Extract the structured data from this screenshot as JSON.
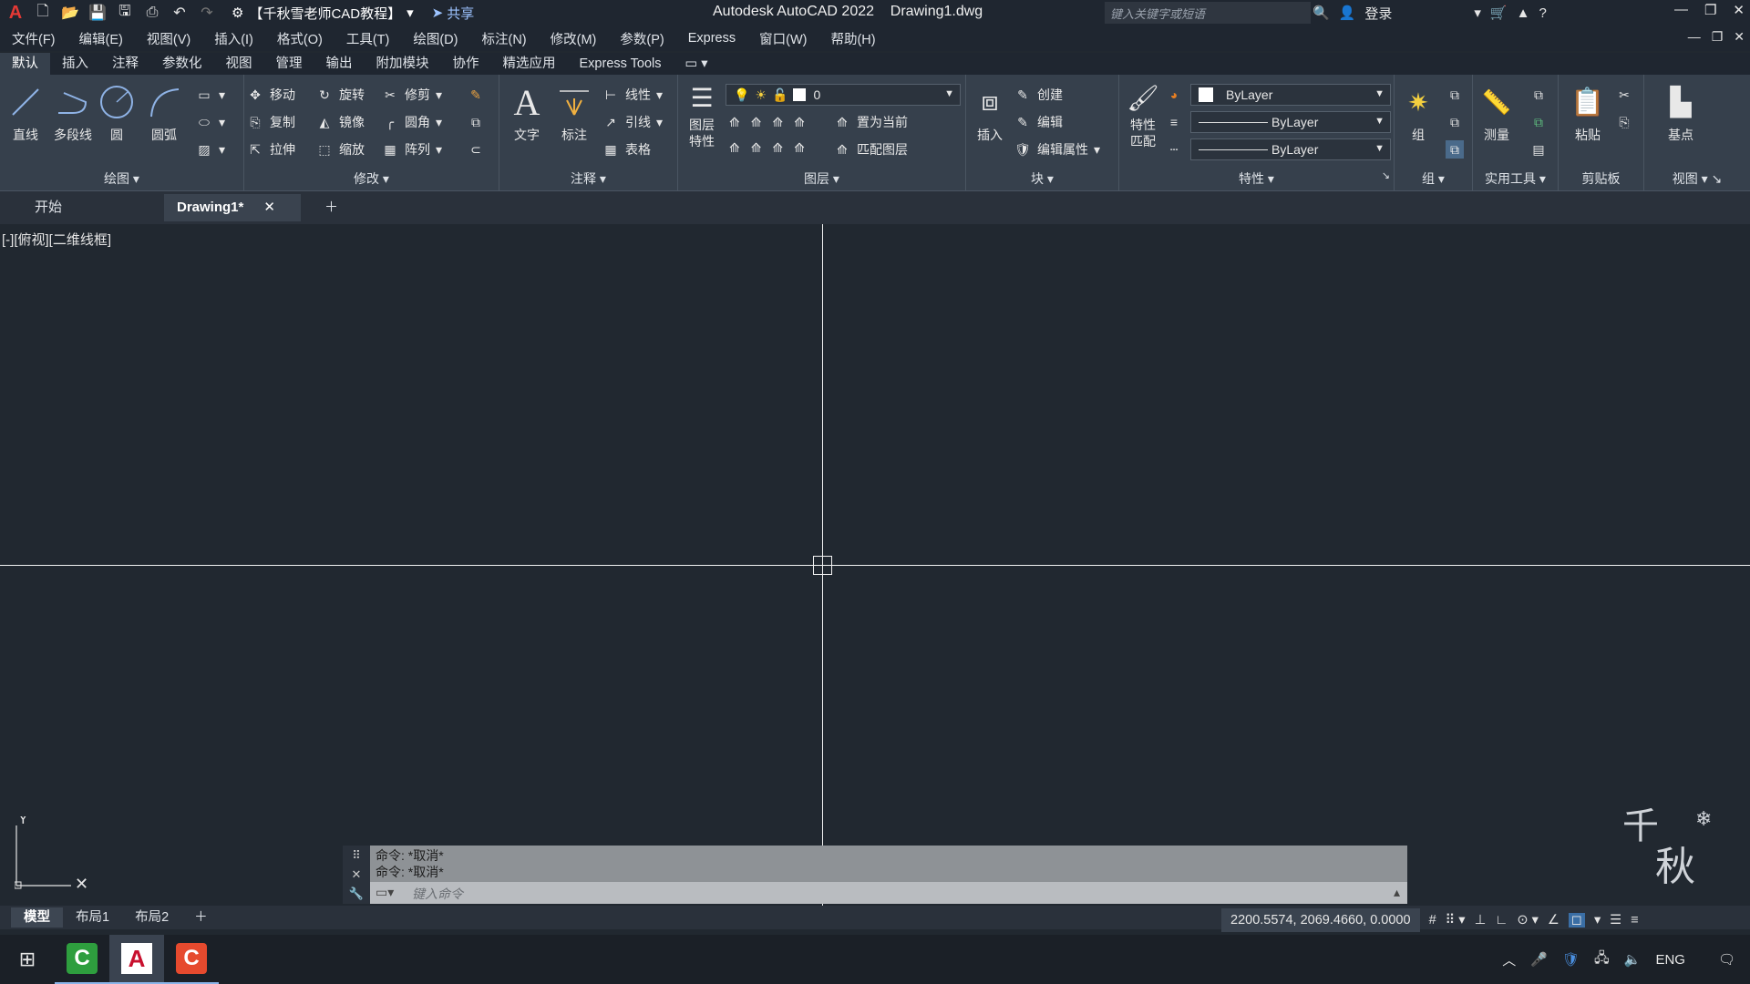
{
  "titlebar": {
    "workspace": "【千秋雪老师CAD教程】",
    "share": "共享",
    "app_title": "Autodesk AutoCAD 2022",
    "doc_title": "Drawing1.dwg",
    "search_placeholder": "键入关键字或短语",
    "login": "登录"
  },
  "menu": [
    "文件(F)",
    "编辑(E)",
    "视图(V)",
    "插入(I)",
    "格式(O)",
    "工具(T)",
    "绘图(D)",
    "标注(N)",
    "修改(M)",
    "参数(P)",
    "Express",
    "窗口(W)",
    "帮助(H)"
  ],
  "ribbon_tabs": [
    "默认",
    "插入",
    "注释",
    "参数化",
    "视图",
    "管理",
    "输出",
    "附加模块",
    "协作",
    "精选应用",
    "Express Tools"
  ],
  "panels": {
    "draw": {
      "title": "绘图",
      "line": "直线",
      "polyline": "多段线",
      "circle": "圆",
      "arc": "圆弧"
    },
    "modify": {
      "title": "修改",
      "move": "移动",
      "rotate": "旋转",
      "trim": "修剪",
      "copy": "复制",
      "mirror": "镜像",
      "fillet": "圆角",
      "stretch": "拉伸",
      "scale": "缩放",
      "array": "阵列"
    },
    "annotation": {
      "title": "注释",
      "text": "文字",
      "dimension": "标注",
      "linear": "线性",
      "leader": "引线",
      "table": "表格"
    },
    "layers": {
      "title": "图层",
      "properties_line1": "图层",
      "properties_line2": "特性",
      "layer_value": "0",
      "set_current": "置为当前",
      "match_layer": "匹配图层"
    },
    "block": {
      "title": "块",
      "insert": "插入",
      "create": "创建",
      "edit": "编辑",
      "edit_attr": "编辑属性"
    },
    "properties": {
      "title": "特性",
      "match_line1": "特性",
      "match_line2": "匹配",
      "color": "ByLayer",
      "lineweight": "ByLayer",
      "linetype": "ByLayer"
    },
    "groups": {
      "title": "组",
      "group": "组"
    },
    "utilities": {
      "title": "实用工具",
      "measure": "测量"
    },
    "clipboard": {
      "title": "剪贴板",
      "paste": "粘贴"
    },
    "view": {
      "title": "视图",
      "basepoint": "基点"
    }
  },
  "doc_tabs": {
    "start": "开始",
    "drawing": "Drawing1*"
  },
  "viewport_label": "[-][俯视][二维线框]",
  "command": {
    "log": [
      "命令: *取消*",
      "命令: *取消*"
    ],
    "placeholder": "键入命令"
  },
  "layout_tabs": [
    "模型",
    "布局1",
    "布局2"
  ],
  "status": {
    "coords": "2200.5574, 2069.4660, 0.0000"
  },
  "tray": {
    "lang": "ENG"
  },
  "colors": {
    "accent": "#36404c",
    "canvas": "#212830",
    "red_brand": "#c8102e"
  }
}
